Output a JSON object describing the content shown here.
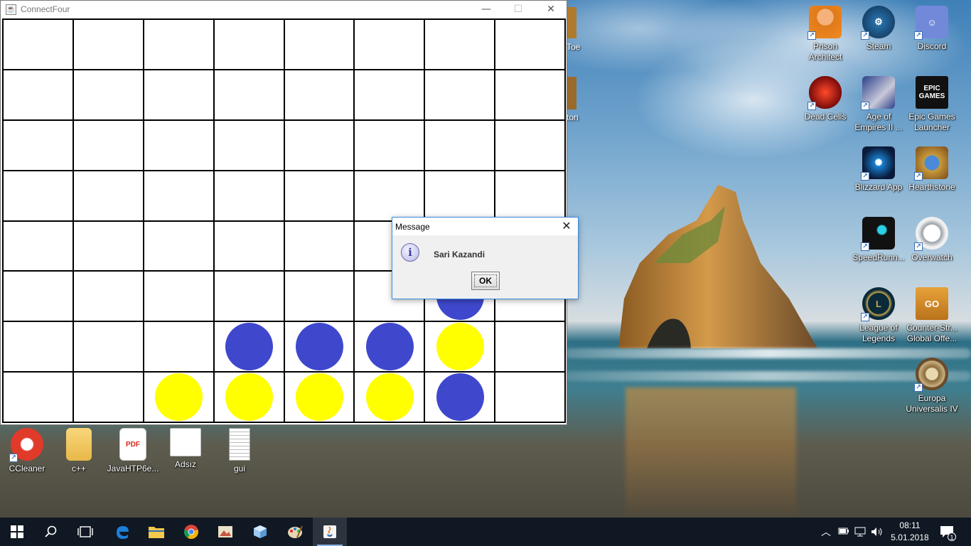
{
  "window": {
    "title": "ConnectFour"
  },
  "board": {
    "columns": 8,
    "rows": 8,
    "discs": [
      [
        "",
        "",
        "",
        "",
        "",
        "",
        "",
        ""
      ],
      [
        "",
        "",
        "",
        "",
        "",
        "",
        "",
        ""
      ],
      [
        "",
        "",
        "",
        "",
        "",
        "",
        "",
        ""
      ],
      [
        "",
        "",
        "",
        "",
        "",
        "",
        "",
        ""
      ],
      [
        "",
        "",
        "",
        "",
        "",
        "",
        "",
        ""
      ],
      [
        "",
        "",
        "",
        "",
        "",
        "",
        "blue",
        ""
      ],
      [
        "",
        "",
        "",
        "blue",
        "blue",
        "blue",
        "yellow",
        ""
      ],
      [
        "",
        "",
        "yellow",
        "yellow",
        "yellow",
        "yellow",
        "blue",
        ""
      ]
    ],
    "colors": {
      "blue": "#3f48cc",
      "yellow": "#ffff00"
    }
  },
  "dialog": {
    "title": "Message",
    "message": "Sari Kazandi",
    "ok_label": "OK"
  },
  "desktop_icons": {
    "prison_architect": "Prison Architect",
    "steam": "Steam",
    "discord": "Discord",
    "dead_cells": "Dead Cells",
    "age_of_empires": "Age of Empires II ...",
    "epic_games": "Epic Games Launcher",
    "blizzard": "Blizzard App",
    "hearthstone": "Hearthstone",
    "speedrunners": "SpeedRunn...",
    "overwatch": "Overwatch",
    "league": "League of Legends",
    "csgo": "Counter-Str... Global Offe...",
    "europa": "Europa Universalis IV",
    "ccleaner": "CCleaner",
    "cpp": "c++",
    "javahtp": "JavaHTP6e...",
    "adsiz": "Adsız",
    "gui": "gui",
    "partial_toe": "Toe",
    "partial_ton": "ton",
    "pdf_badge": "PDF",
    "epic_badge": "EPIC GAMES",
    "go_badge": "GO"
  },
  "taskbar": {
    "time": "08:11",
    "date": "5.01.2018",
    "notification_count": "1"
  }
}
